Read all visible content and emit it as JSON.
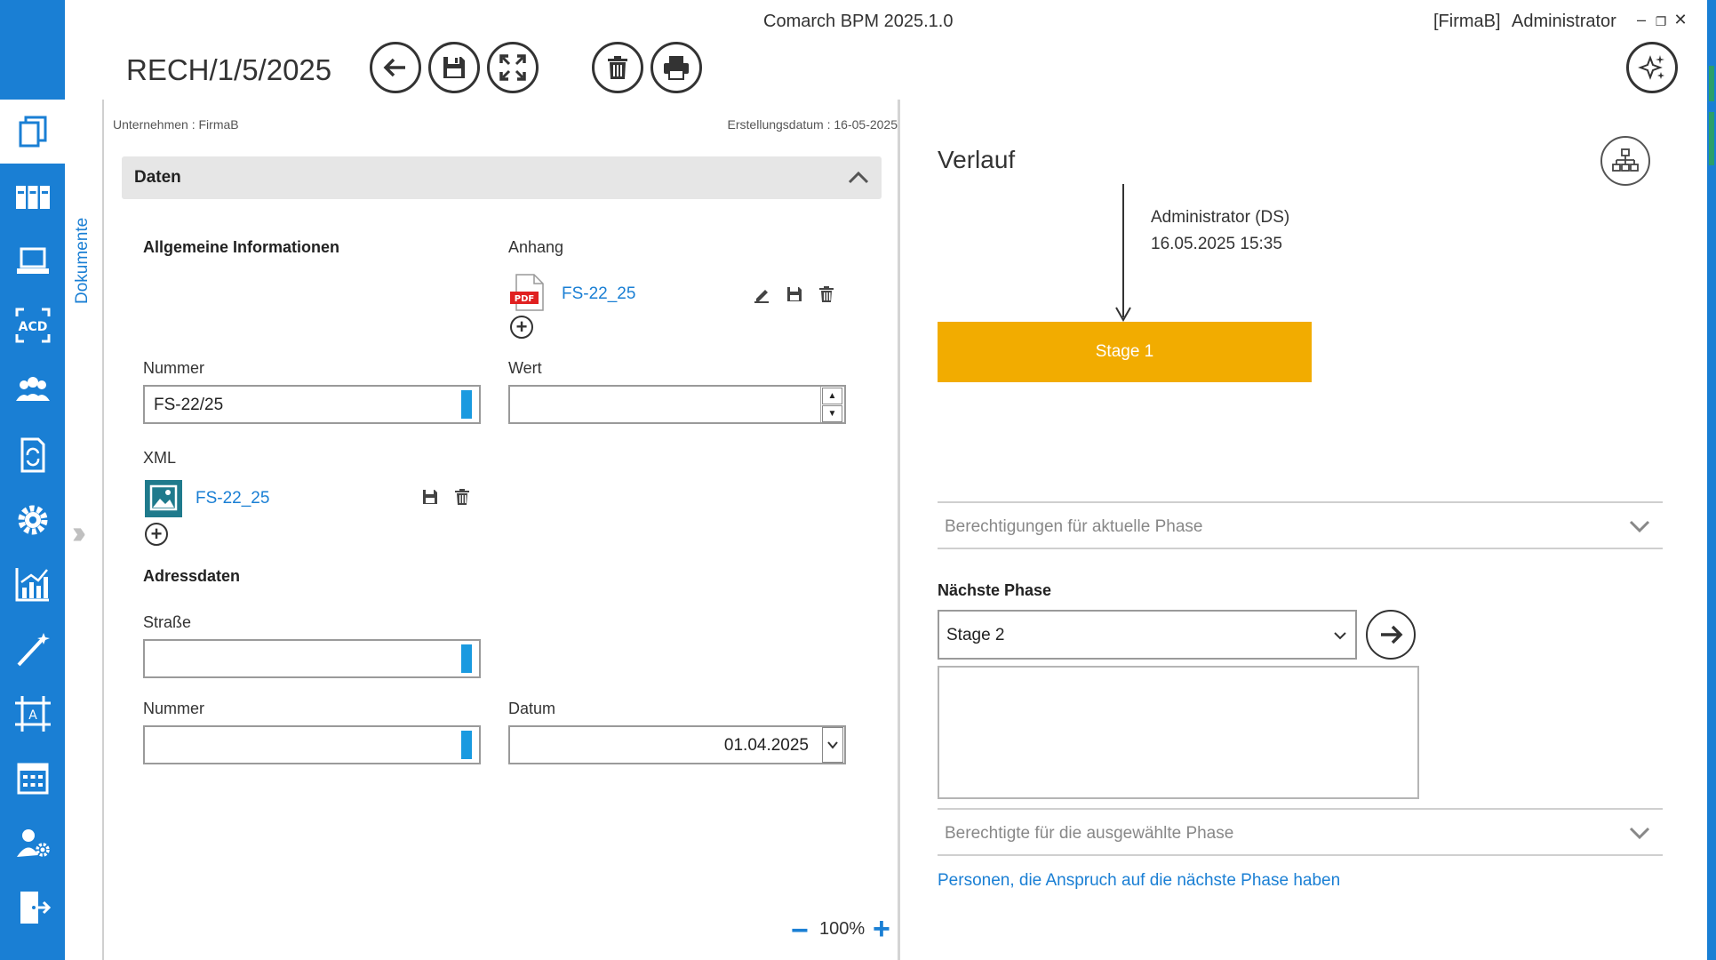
{
  "window": {
    "title": "Comarch BPM 2025.1.0",
    "company": "[FirmaB]",
    "user": "Administrator",
    "controls": {
      "minimize": "–",
      "restore": "❐",
      "close": "✕"
    }
  },
  "document": {
    "title": "RECH/1/5/2025",
    "company_meta": "Unternehmen : FirmaB",
    "created_meta": "Erstellungsdatum : 16-05-2025",
    "tab_label": "Dokumente"
  },
  "toolbar": {
    "buttons": [
      "back-arrow-icon",
      "save-icon",
      "fullscreen-icon",
      "delete-icon",
      "print-icon"
    ],
    "assistant": "sparkles-icon"
  },
  "form": {
    "section_title": "Daten",
    "general_info_label": "Allgemeine Informationen",
    "attachment": {
      "label": "Anhang",
      "file_name": "FS-22_25",
      "file_badge": "PDF"
    },
    "number": {
      "label": "Nummer",
      "value": "FS-22/25"
    },
    "value_field": {
      "label": "Wert",
      "value": ""
    },
    "xml": {
      "label": "XML",
      "file_name": "FS-22_25"
    },
    "address_label": "Adressdaten",
    "street": {
      "label": "Straße",
      "value": ""
    },
    "house_number": {
      "label": "Nummer",
      "value": ""
    },
    "date": {
      "label": "Datum",
      "value": "01.04.2025"
    },
    "zoom": {
      "value": "100%",
      "minus": "−",
      "plus": "+"
    }
  },
  "history": {
    "title": "Verlauf",
    "entry_user": "Administrator (DS)",
    "entry_date": "16.05.2025 15:35",
    "current_stage": "Stage 1",
    "current_stage_color": "#f2ac00",
    "permissions_current": "Berechtigungen für aktuelle Phase",
    "next_phase_label": "Nächste Phase",
    "next_phase_value": "Stage 2",
    "permitted_selected": "Berechtigte für die ausgewählte Phase",
    "persons_link": "Personen, die Anspruch auf die nächste Phase haben"
  },
  "nav": {
    "accent_color": "#1a7fd4",
    "items": [
      "documents-icon",
      "library-icon",
      "laptop-icon",
      "ocr-acd-icon",
      "users-icon",
      "workflow-document-icon",
      "settings-gear-icon",
      "reports-chart-icon",
      "magic-wand-icon",
      "template-designer-icon",
      "calendar-icon",
      "user-settings-icon",
      "logout-icon"
    ]
  }
}
